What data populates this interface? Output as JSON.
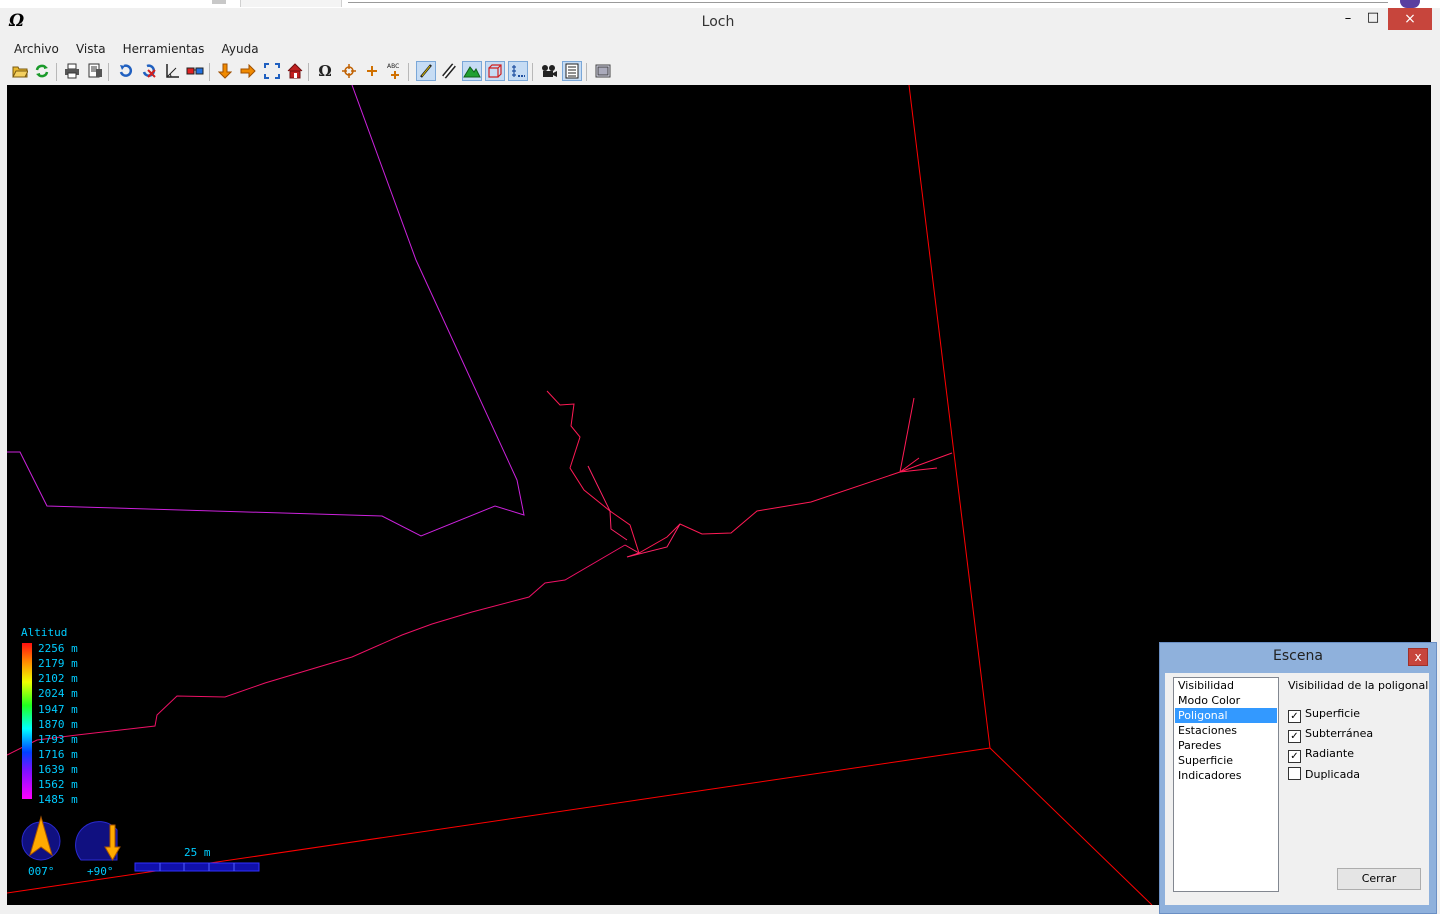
{
  "window": {
    "title": "Loch",
    "app_icon": "Ω",
    "minimize": "–",
    "maximize": "□",
    "close": "×"
  },
  "menu": [
    "Archivo",
    "Vista",
    "Herramientas",
    "Ayuda"
  ],
  "toolbar": {
    "icons": [
      "open-folder-icon",
      "reload-icon",
      "print-icon",
      "print-preview-icon",
      "rotate-icon",
      "rotate-off-icon",
      "angle-icon",
      "stereo-glasses-icon",
      "down-arrow-icon",
      "right-arrow-icon",
      "fullscreen-icon",
      "home-icon",
      "omega-icon",
      "center-icon",
      "plus-icon",
      "labels-icon",
      "centerline-icon",
      "walls-icon",
      "surface-icon",
      "box-icon",
      "indicators-icon",
      "camera-icon",
      "scene-settings-icon",
      "info-icon"
    ],
    "active": [
      "centerline-icon",
      "surface-icon",
      "box-icon",
      "indicators-icon",
      "scene-settings-icon"
    ]
  },
  "viewport": {
    "background": "#000000",
    "altitude_legend": {
      "title": "Altitud",
      "values": [
        "2256 m",
        "2179 m",
        "2102 m",
        "2024 m",
        "1947 m",
        "1870 m",
        "1793 m",
        "1716 m",
        "1639 m",
        "1562 m",
        "1485 m"
      ]
    },
    "compass": {
      "label": "007°"
    },
    "inclination": {
      "label": "+90°"
    },
    "scale_bar": {
      "label": "25 m"
    }
  },
  "dialog": {
    "title": "Escena",
    "close": "x",
    "list": [
      "Visibilidad",
      "Modo Color",
      "Poligonal",
      "Estaciones",
      "Paredes",
      "Superficie",
      "Indicadores"
    ],
    "selected": "Poligonal",
    "heading": "Visibilidad de la poligonal",
    "checkboxes": [
      {
        "label": "Superficie",
        "checked": true
      },
      {
        "label": "Subterránea",
        "checked": true
      },
      {
        "label": "Radiante",
        "checked": true
      },
      {
        "label": "Duplicada",
        "checked": false
      }
    ],
    "button": "Cerrar"
  },
  "colors": {
    "box_line": "#ff0000",
    "survey_low": "#ff00ff",
    "survey_mid": "#ff1a6a",
    "legend_text": "#00ccff",
    "accent": "#3399ff"
  }
}
